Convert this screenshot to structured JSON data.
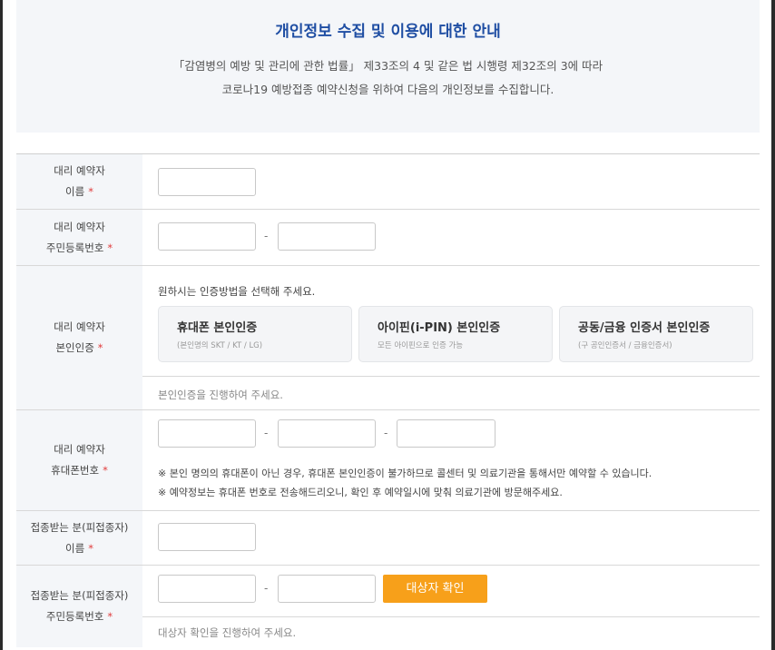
{
  "notice": {
    "title": "개인정보 수집 및 이용에 대한 안내",
    "line1": "「감염병의 예방 및 관리에 관한 법률」 제33조의 4 및 같은 법 시행령 제32조의 3에 따라",
    "line2": "코로나19 예방접종 예약신청을 위하여 다음의 개인정보를 수집합니다."
  },
  "required_mark": "*",
  "dash": "-",
  "rows": {
    "proxy_name": {
      "label1": "대리 예약자",
      "label2": "이름"
    },
    "proxy_rrn": {
      "label1": "대리 예약자",
      "label2": "주민등록번호"
    },
    "proxy_auth": {
      "label1": "대리 예약자",
      "label2": "본인인증",
      "instruction": "원하시는 인증방법을 선택해 주세요.",
      "options": [
        {
          "title": "휴대폰 본인인증",
          "sub": "(본인명의 SKT / KT / LG)"
        },
        {
          "title": "아이핀(i-PIN) 본인인증",
          "sub": "모든 아이핀으로 인증 가능"
        },
        {
          "title": "공동/금융 인증서 본인인증",
          "sub": "(구 공인인증서 / 금융인증서)"
        }
      ],
      "status": "본인인증을 진행하여 주세요."
    },
    "proxy_phone": {
      "label1": "대리 예약자",
      "label2": "휴대폰번호",
      "note1": "※ 본인 명의의 휴대폰이 아닌 경우, 휴대폰 본인인증이 불가하므로 콜센터 및 의료기관을 통해서만 예약할 수 있습니다.",
      "note2": "※ 예약정보는 휴대폰 번호로 전송해드리오니, 확인 후 예약일시에 맞춰 의료기관에 방문해주세요."
    },
    "target_name": {
      "label1": "접종받는 분(피접종자)",
      "label2": "이름"
    },
    "target_rrn": {
      "label1": "접종받는 분(피접종자)",
      "label2": "주민등록번호",
      "confirm_button": "대상자 확인",
      "status": "대상자 확인을 진행하여 주세요."
    }
  },
  "colors": {
    "accent": "#f7a01a",
    "title": "#1f4ea3",
    "required": "#e03b3b"
  }
}
